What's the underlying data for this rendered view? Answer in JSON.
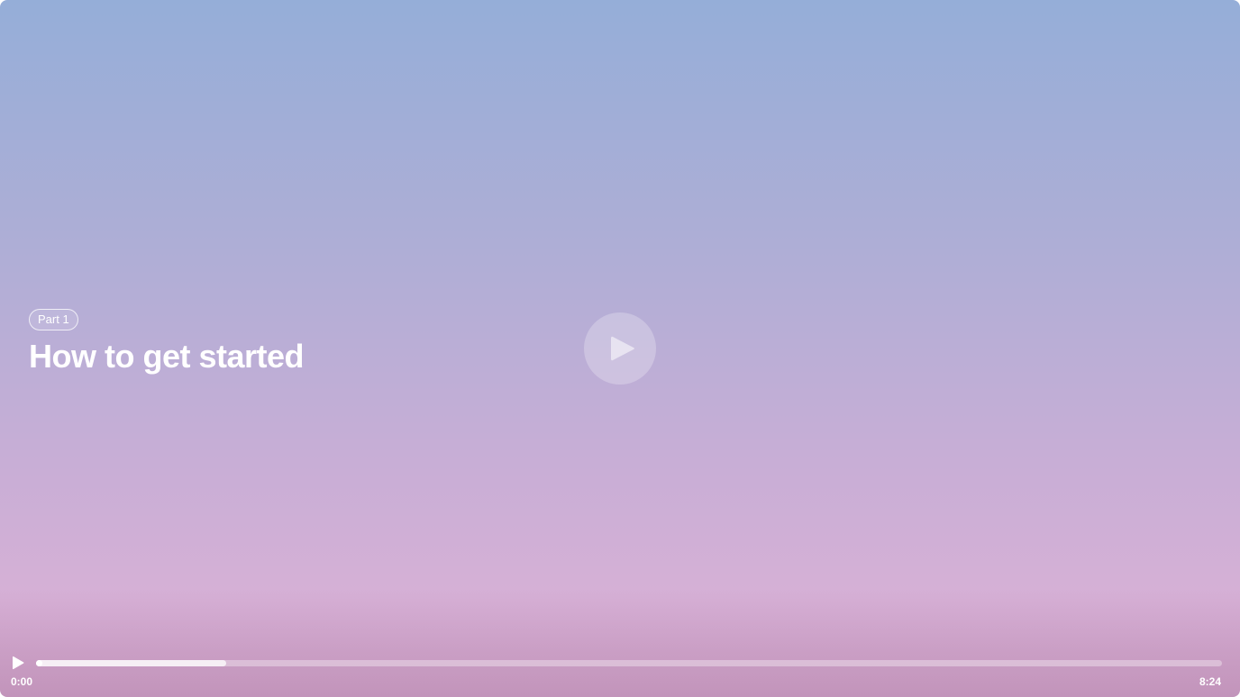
{
  "video": {
    "part_label": "Part 1",
    "title": "How to get started"
  },
  "controls": {
    "current_time": "0:00",
    "duration": "8:24",
    "progress_fraction": 0.0,
    "buffered_fraction": 0.16
  },
  "icons": {
    "big_play": "play-icon",
    "small_play": "play-icon"
  }
}
